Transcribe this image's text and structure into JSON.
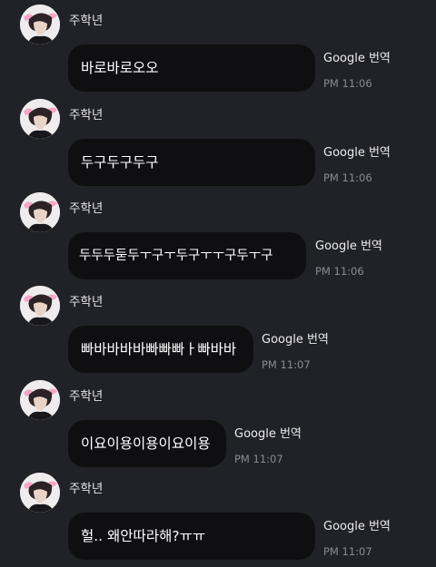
{
  "messages": [
    {
      "sender": "주학년",
      "text": "바로바로오오",
      "translate_label": "Google 번역",
      "time": "PM 11:06"
    },
    {
      "sender": "주학년",
      "text": "두구두구두구",
      "translate_label": "Google 번역",
      "time": "PM 11:06"
    },
    {
      "sender": "주학년",
      "text": "두두두둗두ㅜ구ㅜ두구ㅜㅜ구두ㅜ구",
      "translate_label": "Google 번역",
      "time": "PM 11:06"
    },
    {
      "sender": "주학년",
      "text": "빠바바바바빠빠빠ㅏ빠바바",
      "translate_label": "Google 번역",
      "time": "PM 11:07"
    },
    {
      "sender": "주학년",
      "text": "이요이용이용이요이용",
      "translate_label": "Google 번역",
      "time": "PM 11:07"
    },
    {
      "sender": "주학년",
      "text": "헐.. 왜안따라해?ㅠㅠ",
      "translate_label": "Google 번역",
      "time": "PM 11:07"
    }
  ],
  "icons": {
    "avatar": "profile-photo-avatar"
  }
}
